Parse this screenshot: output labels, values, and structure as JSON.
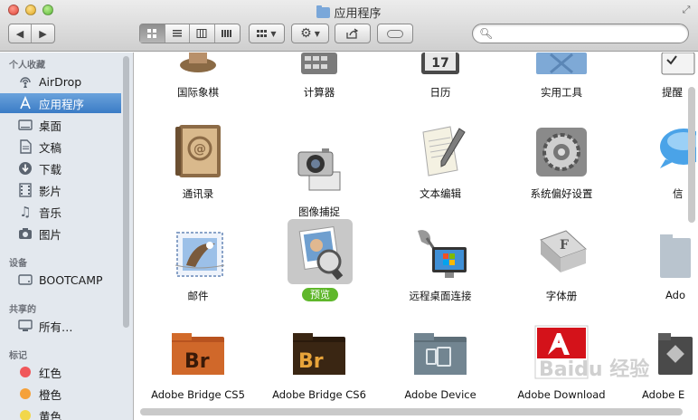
{
  "window": {
    "title": "应用程序"
  },
  "toolbar": {
    "back": "◀",
    "forward": "▶",
    "view_modes": [
      "icon",
      "list",
      "columns",
      "coverflow"
    ],
    "search_placeholder": ""
  },
  "sidebar": {
    "sections": [
      {
        "header": "个人收藏",
        "items": [
          {
            "label": "AirDrop",
            "icon": "airdrop-icon"
          },
          {
            "label": "应用程序",
            "icon": "applications-icon",
            "selected": true
          },
          {
            "label": "桌面",
            "icon": "desktop-icon"
          },
          {
            "label": "文稿",
            "icon": "documents-icon"
          },
          {
            "label": "下载",
            "icon": "downloads-icon"
          },
          {
            "label": "影片",
            "icon": "movies-icon"
          },
          {
            "label": "音乐",
            "icon": "music-icon"
          },
          {
            "label": "图片",
            "icon": "pictures-icon"
          }
        ]
      },
      {
        "header": "设备",
        "items": [
          {
            "label": "BOOTCAMP",
            "icon": "disk-icon"
          }
        ]
      },
      {
        "header": "共享的",
        "items": [
          {
            "label": "所有…",
            "icon": "network-icon"
          }
        ]
      },
      {
        "header": "标记",
        "items": [
          {
            "label": "红色",
            "color": "#f0575a"
          },
          {
            "label": "橙色",
            "color": "#f5a13a"
          },
          {
            "label": "黄色",
            "color": "#f2d74a"
          }
        ]
      }
    ]
  },
  "apps": {
    "row1": [
      "国际象棋",
      "计算器",
      "日历",
      "实用工具",
      "提醒"
    ],
    "row2": [
      "通讯录",
      "图像捕捉",
      "文本编辑",
      "系统偏好设置",
      "信"
    ],
    "row3": [
      "邮件",
      "预览",
      "远程桌面连接",
      "字体册",
      "Ado"
    ],
    "row4": [
      "Adobe Bridge CS5",
      "Adobe Bridge CS6",
      "Adobe Device",
      "Adobe Download",
      "Adobe E"
    ]
  },
  "watermark": "Baidu 经验"
}
